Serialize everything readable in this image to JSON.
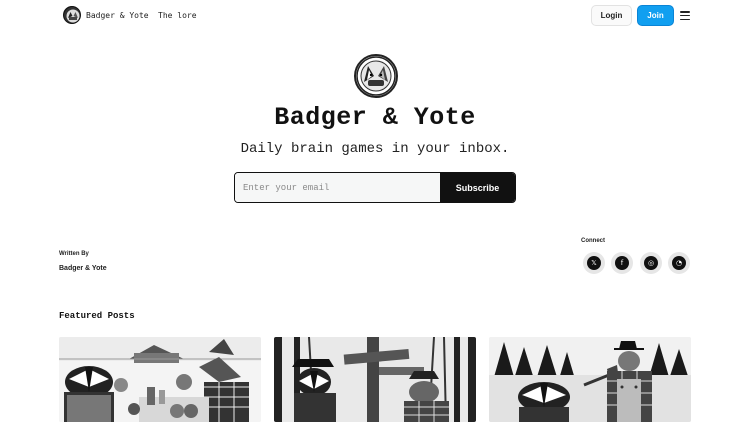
{
  "nav": {
    "brand_name": "Badger & Yote",
    "lore_link": "The lore",
    "login_label": "Login",
    "join_label": "Join",
    "menu_icon": "hamburger-menu-icon"
  },
  "hero": {
    "title": "Badger & Yote",
    "subtitle": "Daily brain games in your inbox.",
    "email_placeholder": "Enter your email",
    "email_value": "",
    "subscribe_label": "Subscribe"
  },
  "author": {
    "label": "Written By",
    "name": "Badger & Yote"
  },
  "connect": {
    "label": "Connect",
    "links": [
      {
        "icon": "x-twitter-icon",
        "glyph": "𝕏"
      },
      {
        "icon": "facebook-icon",
        "glyph": "f"
      },
      {
        "icon": "instagram-icon",
        "glyph": "◎"
      },
      {
        "icon": "rss-icon",
        "glyph": "◔"
      }
    ]
  },
  "featured": {
    "title": "Featured Posts"
  },
  "colors": {
    "join_accent": "#119ff0",
    "subscribe_bg": "#111111",
    "input_bg": "#f6f7f7"
  }
}
